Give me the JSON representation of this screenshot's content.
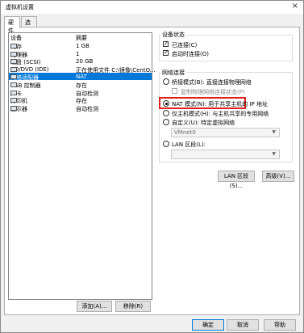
{
  "window": {
    "title": "虚拟机设置",
    "close_icon": "×"
  },
  "tabs": [
    {
      "label": "硬件"
    },
    {
      "label": "选项"
    }
  ],
  "device_list": {
    "header": {
      "device": "设备",
      "summary": "摘要"
    },
    "rows": [
      {
        "icon": "memory-icon",
        "device": "内存",
        "summary": "1 GB"
      },
      {
        "icon": "processor-icon",
        "device": "处理器",
        "summary": "1"
      },
      {
        "icon": "harddisk-icon",
        "device": "硬盘 (SCSI)",
        "summary": "20 GB"
      },
      {
        "icon": "cdrom-icon",
        "device": "CD/DVD (IDE)",
        "summary": "正在使用文件 C:\\镜像\\CentO..."
      },
      {
        "icon": "network-adapter-icon",
        "device": "网络适配器",
        "summary": "NAT",
        "selected": true
      },
      {
        "icon": "usb-icon",
        "device": "USB 控制器",
        "summary": "存在"
      },
      {
        "icon": "sound-icon",
        "device": "声卡",
        "summary": "自动检测"
      },
      {
        "icon": "printer-icon",
        "device": "打印机",
        "summary": "存在"
      },
      {
        "icon": "display-icon",
        "device": "显示器",
        "summary": "自动检测"
      }
    ]
  },
  "list_buttons": {
    "add": "添加(A)...",
    "remove": "移除(R)"
  },
  "device_status": {
    "title": "设备状态",
    "connected": {
      "label": "已连接(C)",
      "checked": true
    },
    "connect_on_power_on": {
      "label": "启动时连接(O)",
      "checked": true
    }
  },
  "network_connection": {
    "title": "网络连接",
    "bridged": "桥接模式(B): 直接连接物理网络",
    "replicate": "复制物理网络连接状态(P)",
    "nat": "NAT 模式(N): 用于共享主机的 IP 地址",
    "hostonly": "仅主机模式(H): 与主机共享的专用网络",
    "custom": "自定义(U): 特定虚拟网络",
    "custom_select": "VMnet0",
    "lan_segment": "LAN 区段(L):",
    "lan_select": "",
    "selected": "nat"
  },
  "right_buttons": {
    "lan_segments": "LAN 区段(S)...",
    "advanced": "高级(V)..."
  },
  "bottom_buttons": {
    "ok": "确定",
    "cancel": "取消",
    "help": "帮助"
  },
  "colors": {
    "selection": "#0078d7",
    "highlight_box": "#e02020"
  }
}
